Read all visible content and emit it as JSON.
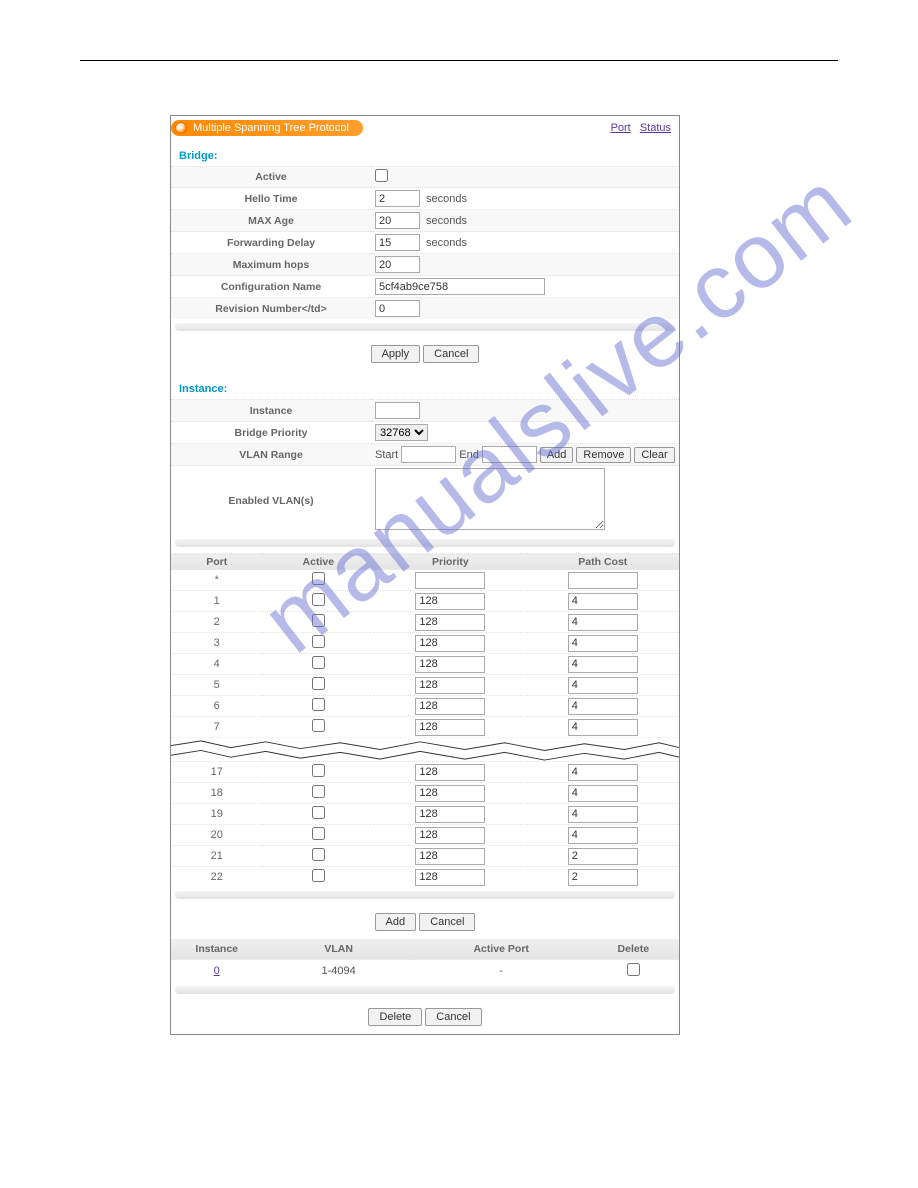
{
  "header": {
    "title": "Multiple Spanning Tree Protocol",
    "links": {
      "port": "Port",
      "status": "Status"
    }
  },
  "bridge": {
    "section": "Bridge:",
    "labels": {
      "active": "Active",
      "hello_time": "Hello Time",
      "max_age": "MAX Age",
      "fwd_delay": "Forwarding Delay",
      "max_hops": "Maximum hops",
      "config_name": "Configuration Name",
      "revision": "Revision Number</td>"
    },
    "values": {
      "hello_time": "2",
      "max_age": "20",
      "fwd_delay": "15",
      "max_hops": "20",
      "config_name": "5cf4ab9ce758",
      "revision": "0"
    },
    "units": {
      "seconds": "seconds"
    },
    "buttons": {
      "apply": "Apply",
      "cancel": "Cancel"
    }
  },
  "instance": {
    "section": "Instance:",
    "labels": {
      "instance": "Instance",
      "bridge_priority": "Bridge Priority",
      "vlan_range": "VLAN Range",
      "enabled_vlans": "Enabled VLAN(s)"
    },
    "bridge_priority_sel": "32768",
    "vlan_range": {
      "start": "Start",
      "end": "End"
    },
    "buttons": {
      "add": "Add",
      "remove": "Remove",
      "clear": "Clear",
      "cancel": "Cancel"
    }
  },
  "ports": {
    "headers": {
      "port": "Port",
      "active": "Active",
      "priority": "Priority",
      "path_cost": "Path Cost"
    },
    "rows_top": [
      {
        "port": "*",
        "priority": "",
        "path_cost": ""
      },
      {
        "port": "1",
        "priority": "128",
        "path_cost": "4"
      },
      {
        "port": "2",
        "priority": "128",
        "path_cost": "4"
      },
      {
        "port": "3",
        "priority": "128",
        "path_cost": "4"
      },
      {
        "port": "4",
        "priority": "128",
        "path_cost": "4"
      },
      {
        "port": "5",
        "priority": "128",
        "path_cost": "4"
      },
      {
        "port": "6",
        "priority": "128",
        "path_cost": "4"
      },
      {
        "port": "7",
        "priority": "128",
        "path_cost": "4"
      }
    ],
    "rows_bottom": [
      {
        "port": "17",
        "priority": "128",
        "path_cost": "4"
      },
      {
        "port": "18",
        "priority": "128",
        "path_cost": "4"
      },
      {
        "port": "19",
        "priority": "128",
        "path_cost": "4"
      },
      {
        "port": "20",
        "priority": "128",
        "path_cost": "4"
      },
      {
        "port": "21",
        "priority": "128",
        "path_cost": "2"
      },
      {
        "port": "22",
        "priority": "128",
        "path_cost": "2"
      }
    ]
  },
  "summary": {
    "headers": {
      "instance": "Instance",
      "vlan": "VLAN",
      "active_port": "Active Port",
      "delete": "Delete"
    },
    "row": {
      "instance": "0",
      "vlan": "1-4094",
      "active_port": "-"
    },
    "buttons": {
      "delete": "Delete",
      "cancel": "Cancel"
    }
  },
  "watermark": "manualslive.com"
}
